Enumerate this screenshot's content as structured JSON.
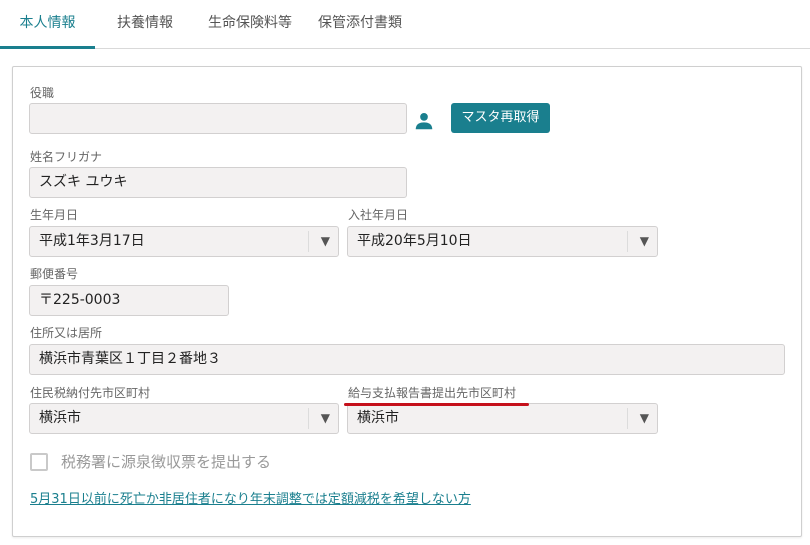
{
  "tabs": [
    {
      "label": "本人情報",
      "active": true
    },
    {
      "label": "扶養情報",
      "active": false
    },
    {
      "label": "生命保険料等",
      "active": false
    },
    {
      "label": "保管添付書類",
      "active": false
    }
  ],
  "form": {
    "position": {
      "label": "役職",
      "value": ""
    },
    "person_icon": "person-icon",
    "refetch_button": "マスタ再取得",
    "name_kana": {
      "label": "姓名フリガナ",
      "value": "スズキ ユウキ"
    },
    "birth_date": {
      "label": "生年月日",
      "value": "平成1年3月17日"
    },
    "hire_date": {
      "label": "入社年月日",
      "value": "平成20年5月10日"
    },
    "postal_code": {
      "label": "郵便番号",
      "value": "〒225-0003"
    },
    "address": {
      "label": "住所又は居所",
      "value": "横浜市青葉区１丁目２番地３"
    },
    "resident_tax_city": {
      "label": "住民税納付先市区町村",
      "value": "横浜市"
    },
    "salary_report_city": {
      "label": "給与支払報告書提出先市区町村",
      "value": "横浜市"
    },
    "withholding_checkbox": {
      "label": "税務署に源泉徴収票を提出する",
      "checked": false
    },
    "deceased_link": "5月31日以前に死亡か非居住者になり年末調整では定額減税を希望しない方",
    "dropdown_arrow": "▼"
  },
  "colors": {
    "accent": "#1a7f8e",
    "highlight_underline": "#c5101b",
    "field_bg": "#f3f1f1"
  }
}
